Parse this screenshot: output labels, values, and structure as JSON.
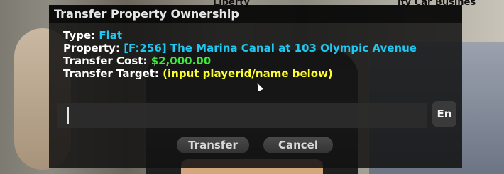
{
  "background": {
    "top_text_left": "Liberty",
    "top_text_right": "ity Car Busines"
  },
  "dialog": {
    "title": "Transfer Property Ownership",
    "type_label": "Type:",
    "type_value": "Flat",
    "property_label": "Property:",
    "property_value": "[F:256] The Marina Canal at 103 Olympic Avenue",
    "cost_label": "Transfer Cost:",
    "cost_value": "$2,000.00",
    "target_label": "Transfer Target:",
    "target_value": "(input playerid/name below)",
    "input_value": "",
    "language_label": "En",
    "transfer_button": "Transfer",
    "cancel_button": "Cancel"
  },
  "colors": {
    "cyan": "#1ec8f0",
    "green": "#3ee83a",
    "yellow": "#ffff2e"
  }
}
